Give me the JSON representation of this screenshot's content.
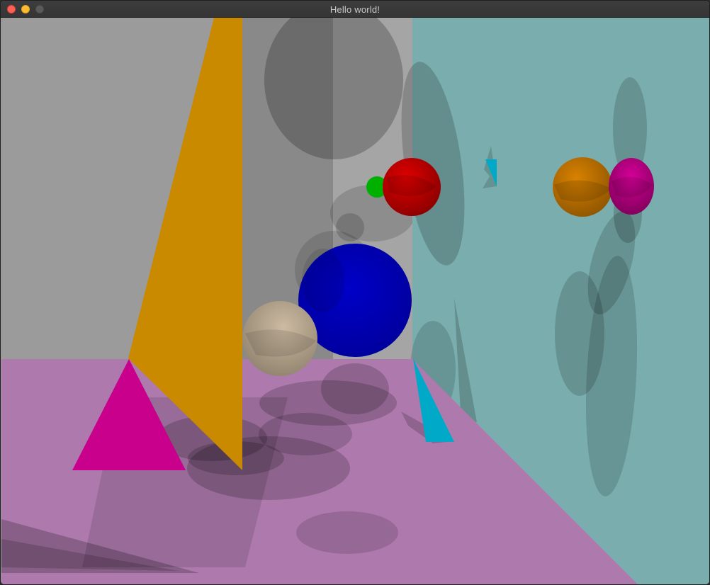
{
  "window": {
    "title": "Hello world!",
    "controls": {
      "close_color": "#fe5f57",
      "minimize_color": "#febc2e",
      "zoom_color": "#5a5a5a"
    }
  },
  "scene": {
    "colors": {
      "back_wall": "#9b9b9b",
      "right_wall": "#7aaeae",
      "floor": "#ae7aae",
      "orange_panel": "#c98a00",
      "magenta_triangle": "#c8008c",
      "cyan_triangle": "#00a9c8",
      "red_sphere": "#c30000",
      "green_sphere": "#00b000",
      "blue_sphere": "#0000c0",
      "beige_sphere": "#b9a890",
      "orange_sphere": "#cc7a00",
      "magenta_sphere": "#c8007f"
    }
  }
}
